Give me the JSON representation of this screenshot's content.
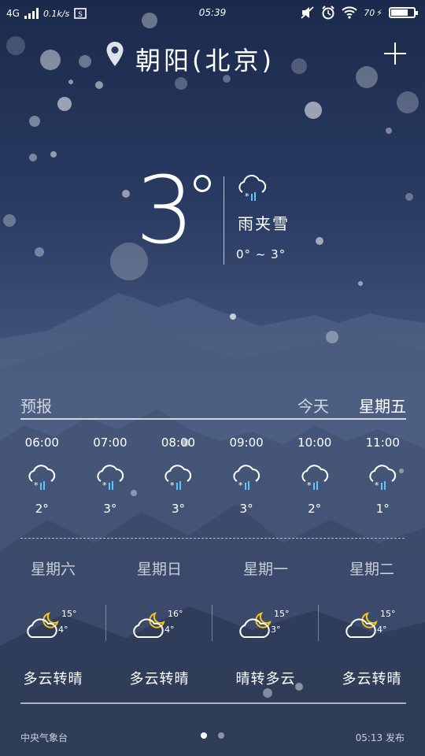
{
  "status_bar": {
    "network": "4G",
    "speed": "0.1k/s",
    "time": "05:39",
    "battery": "70",
    "battery_level": 0.7
  },
  "header": {
    "city": "朝阳(北京)"
  },
  "current": {
    "temperature": "3",
    "condition": "雨夹雪",
    "range": "0° ~ 3°",
    "icon": "cloud-sleet-icon"
  },
  "forecast": {
    "title": "预报",
    "today_label": "今天",
    "day_label": "星期五",
    "hourly": [
      {
        "time": "06:00",
        "temp": "2°",
        "icon": "cloud-sleet-icon"
      },
      {
        "time": "07:00",
        "temp": "3°",
        "icon": "cloud-sleet-icon"
      },
      {
        "time": "08:00",
        "temp": "3°",
        "icon": "cloud-sleet-icon"
      },
      {
        "time": "09:00",
        "temp": "3°",
        "icon": "cloud-sleet-icon"
      },
      {
        "time": "10:00",
        "temp": "2°",
        "icon": "cloud-sleet-icon"
      },
      {
        "time": "11:00",
        "temp": "1°",
        "icon": "cloud-sleet-icon"
      }
    ],
    "daily": [
      {
        "day": "星期六",
        "high": "15°",
        "low": "4°",
        "desc": "多云转晴",
        "icon": "cloud-moon-icon"
      },
      {
        "day": "星期日",
        "high": "16°",
        "low": "4°",
        "desc": "多云转晴",
        "icon": "cloud-moon-icon"
      },
      {
        "day": "星期一",
        "high": "15°",
        "low": "3°",
        "desc": "晴转多云",
        "icon": "cloud-moon-icon"
      },
      {
        "day": "星期二",
        "high": "15°",
        "low": "4°",
        "desc": "多云转晴",
        "icon": "cloud-moon-icon"
      }
    ]
  },
  "footer": {
    "source": "中央气象台",
    "publish": "05:13 发布",
    "pages": 2,
    "active_page": 1
  }
}
